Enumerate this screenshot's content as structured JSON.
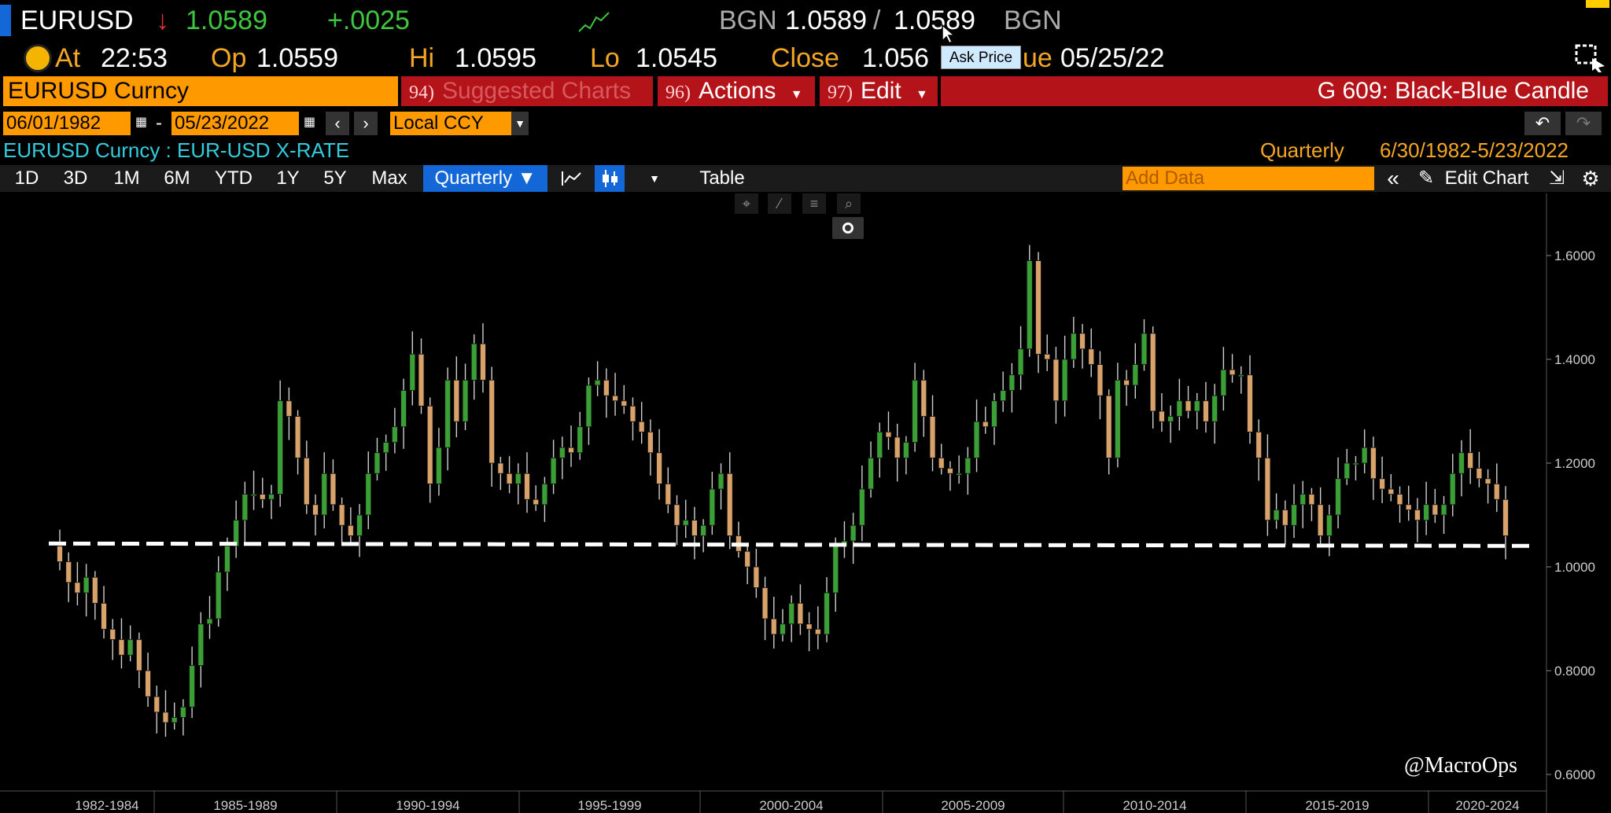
{
  "header": {
    "ticker": "EURUSD",
    "arrow": "↓",
    "last": "1.0589",
    "change": "+.0025",
    "source_left": "BGN",
    "bid": "1.0589",
    "ask": "1.0589",
    "source_right": "BGN"
  },
  "quote": {
    "at_label": "At",
    "at_value": "22:53",
    "op_label": "Op",
    "op_value": "1.0559",
    "hi_label": "Hi",
    "hi_value": "1.0595",
    "lo_label": "Lo",
    "lo_value": "1.0545",
    "close_label": "Close",
    "close_value": "1.056",
    "due_label": "ue",
    "due_value": "05/25/22",
    "tooltip": "Ask Price"
  },
  "menubar": {
    "security": "EURUSD Curncy",
    "suggested_num": "94)",
    "suggested_label": "Suggested Charts",
    "actions_num": "96)",
    "actions_label": "Actions",
    "edit_num": "97)",
    "edit_label": "Edit",
    "template": "G 609: Black-Blue Candle"
  },
  "dates": {
    "start": "06/01/1982",
    "separator": "-",
    "end": "05/23/2022",
    "currency": "Local CCY"
  },
  "info": {
    "subtitle": "EURUSD Curncy : EUR-USD X-RATE",
    "period": "Quarterly",
    "range": "6/30/1982-5/23/2022"
  },
  "toolbar": {
    "tabs": [
      "1D",
      "3D",
      "1M",
      "6M",
      "YTD",
      "1Y",
      "5Y",
      "Max"
    ],
    "frequency": "Quarterly ▼",
    "table": "Table",
    "add_data_placeholder": "Add Data",
    "edit_chart": "Edit Chart"
  },
  "watermark": "@MacroOps",
  "colors": {
    "up": "#3aa035",
    "down": "#d8a26a",
    "wick": "#cfcfcf",
    "accent_orange": "#ff9900",
    "accent_red": "#b5131a",
    "accent_blue": "#1467d6"
  },
  "chart_data": {
    "type": "candlestick",
    "title": "",
    "frequency": "Quarterly",
    "x_groups": [
      "1982-1984",
      "1985-1989",
      "1990-1994",
      "1995-1999",
      "2000-2004",
      "2005-2009",
      "2010-2014",
      "2015-2019",
      "2020-2024"
    ],
    "y_ticks": [
      "1.6000",
      "1.4000",
      "1.2000",
      "1.0000",
      "0.8000",
      "0.6000"
    ],
    "ylim": [
      0.6,
      1.65
    ],
    "support_level": 1.045,
    "series": [
      {
        "close": [
          1.01,
          0.97,
          0.95,
          0.98,
          0.93,
          0.88,
          0.86,
          0.83,
          0.86,
          0.8,
          0.75,
          0.72,
          0.7,
          0.71,
          0.73,
          0.81,
          0.89,
          0.9,
          0.99,
          1.04,
          1.09,
          1.14,
          1.14,
          1.13,
          1.14,
          1.32,
          1.29,
          1.21,
          1.12,
          1.1,
          1.18,
          1.12,
          1.08,
          1.06,
          1.1,
          1.18,
          1.22,
          1.24,
          1.27,
          1.34,
          1.41,
          1.31,
          1.16,
          1.23,
          1.36,
          1.28,
          1.36,
          1.43,
          1.36,
          1.2,
          1.18,
          1.16,
          1.18,
          1.13,
          1.12,
          1.16,
          1.21,
          1.23,
          1.22,
          1.27,
          1.35,
          1.36,
          1.33,
          1.32,
          1.31,
          1.28,
          1.26,
          1.22,
          1.16,
          1.12,
          1.08,
          1.09,
          1.06,
          1.08,
          1.15,
          1.18,
          1.06,
          1.03,
          1.0,
          0.96,
          0.9,
          0.87,
          0.89,
          0.93,
          0.89,
          0.88,
          0.87,
          0.95,
          1.04,
          1.05,
          1.08,
          1.15,
          1.21,
          1.26,
          1.25,
          1.21,
          1.24,
          1.36,
          1.29,
          1.21,
          1.19,
          1.18,
          1.18,
          1.21,
          1.28,
          1.27,
          1.32,
          1.34,
          1.37,
          1.42,
          1.59,
          1.41,
          1.4,
          1.32,
          1.4,
          1.45,
          1.42,
          1.39,
          1.33,
          1.21,
          1.36,
          1.35,
          1.39,
          1.45,
          1.3,
          1.28,
          1.29,
          1.32,
          1.3,
          1.32,
          1.28,
          1.33,
          1.38,
          1.37,
          1.37,
          1.26,
          1.21,
          1.09,
          1.11,
          1.08,
          1.12,
          1.14,
          1.12,
          1.06,
          1.1,
          1.17,
          1.2,
          1.2,
          1.23,
          1.17,
          1.15,
          1.14,
          1.12,
          1.11,
          1.09,
          1.12,
          1.1,
          1.12,
          1.18,
          1.22,
          1.19,
          1.17,
          1.16,
          1.13,
          1.06
        ]
      }
    ]
  }
}
